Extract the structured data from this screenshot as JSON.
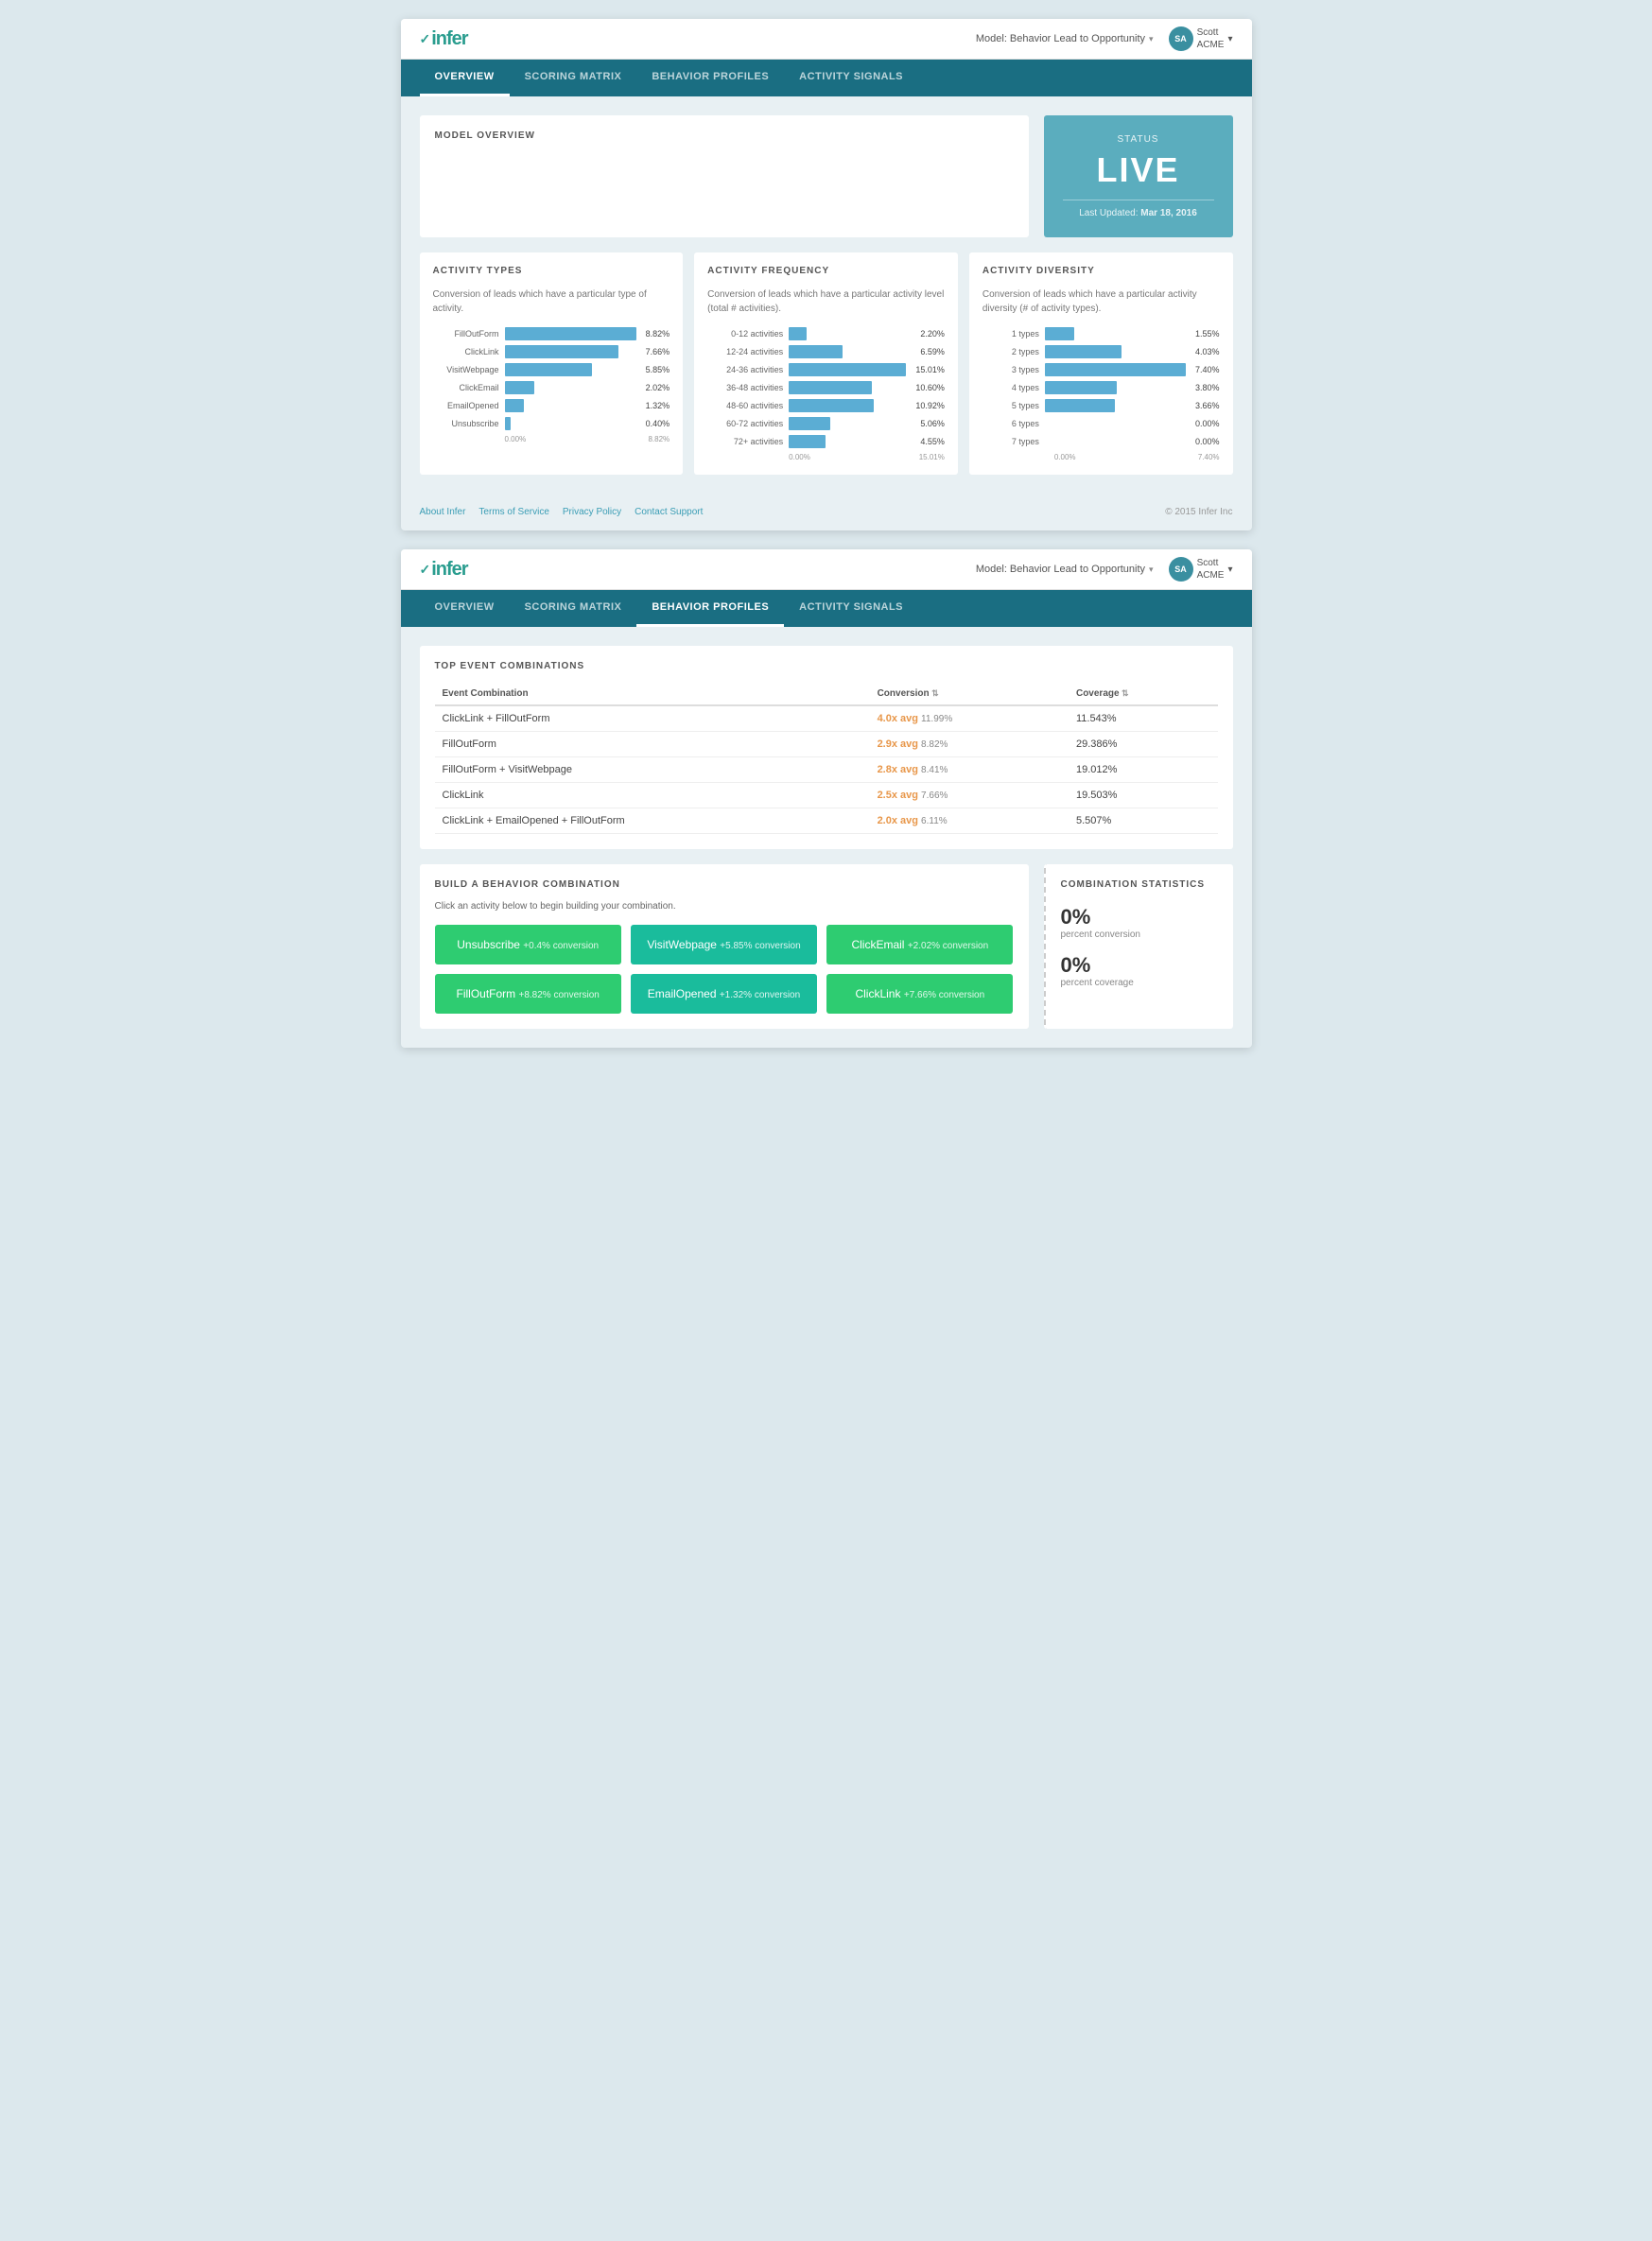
{
  "screen1": {
    "logo": "infer",
    "model_selector": "Model: Behavior Lead to Opportunity",
    "user_name": "Scott",
    "user_company": "ACME",
    "nav_tabs": [
      "OVERVIEW",
      "SCORING MATRIX",
      "BEHAVIOR PROFILES",
      "ACTIVITY SIGNALS"
    ],
    "active_tab": "OVERVIEW",
    "model_overview_title": "MODEL OVERVIEW",
    "status_label": "STATUS",
    "status_value": "LIVE",
    "status_updated": "Last Updated:",
    "status_date": "Mar 18, 2016",
    "activity_types": {
      "title": "ACTIVITY TYPES",
      "description": "Conversion of leads which have a particular type of activity.",
      "bars": [
        {
          "label": "FillOutForm",
          "value": 8.82,
          "max": 8.82,
          "display": "8.82%"
        },
        {
          "label": "ClickLink",
          "value": 7.66,
          "max": 8.82,
          "display": "7.66%"
        },
        {
          "label": "VisitWebpage",
          "value": 5.85,
          "max": 8.82,
          "display": "5.85%"
        },
        {
          "label": "ClickEmail",
          "value": 2.02,
          "max": 8.82,
          "display": "2.02%"
        },
        {
          "label": "EmailOpened",
          "value": 1.32,
          "max": 8.82,
          "display": "1.32%"
        },
        {
          "label": "Unsubscribe",
          "value": 0.4,
          "max": 8.82,
          "display": "0.40%"
        }
      ],
      "axis_min": "0.00%",
      "axis_max": "8.82%"
    },
    "activity_frequency": {
      "title": "ACTIVITY FREQUENCY",
      "description": "Conversion of leads which have a particular activity level (total # activities).",
      "bars": [
        {
          "label": "0-12 activities",
          "value": 2.2,
          "max": 15.01,
          "display": "2.20%"
        },
        {
          "label": "12-24 activities",
          "value": 6.59,
          "max": 15.01,
          "display": "6.59%"
        },
        {
          "label": "24-36 activities",
          "value": 15.01,
          "max": 15.01,
          "display": "15.01%"
        },
        {
          "label": "36-48 activities",
          "value": 10.6,
          "max": 15.01,
          "display": "10.60%"
        },
        {
          "label": "48-60 activities",
          "value": 10.92,
          "max": 15.01,
          "display": "10.92%"
        },
        {
          "label": "60-72 activities",
          "value": 5.06,
          "max": 15.01,
          "display": "5.06%"
        },
        {
          "label": "72+ activities",
          "value": 4.55,
          "max": 15.01,
          "display": "4.55%"
        }
      ],
      "axis_min": "0.00%",
      "axis_max": "15.01%"
    },
    "activity_diversity": {
      "title": "ACTIVITY DIVERSITY",
      "description": "Conversion of leads which have a particular activity diversity (# of activity types).",
      "bars": [
        {
          "label": "1 types",
          "value": 1.55,
          "max": 7.4,
          "display": "1.55%"
        },
        {
          "label": "2 types",
          "value": 4.03,
          "max": 7.4,
          "display": "4.03%"
        },
        {
          "label": "3 types",
          "value": 7.4,
          "max": 7.4,
          "display": "7.40%"
        },
        {
          "label": "4 types",
          "value": 3.8,
          "max": 7.4,
          "display": "3.80%"
        },
        {
          "label": "5 types",
          "value": 3.66,
          "max": 7.4,
          "display": "3.66%"
        },
        {
          "label": "6 types",
          "value": 0.0,
          "max": 7.4,
          "display": "0.00%"
        },
        {
          "label": "7 types",
          "value": 0.0,
          "max": 7.4,
          "display": "0.00%"
        }
      ],
      "axis_min": "0.00%",
      "axis_max": "7.40%"
    },
    "footer": {
      "links": [
        "About Infer",
        "Terms of Service",
        "Privacy Policy",
        "Contact Support"
      ],
      "copyright": "© 2015 Infer Inc"
    }
  },
  "screen2": {
    "logo": "infer",
    "model_selector": "Model: Behavior Lead to Opportunity",
    "user_name": "Scott",
    "user_company": "ACME",
    "nav_tabs": [
      "OVERVIEW",
      "SCORING MATRIX",
      "BEHAVIOR PROFILES",
      "ACTIVITY SIGNALS"
    ],
    "active_tab": "BEHAVIOR PROFILES",
    "top_event_combinations": {
      "title": "TOP EVENT COMBINATIONS",
      "columns": [
        "Event Combination",
        "Conversion",
        "Coverage"
      ],
      "rows": [
        {
          "event": "ClickLink + FillOutForm",
          "conv_mult": "4.0x avg",
          "conv_pct": "11.99%",
          "coverage": "11.543%"
        },
        {
          "event": "FillOutForm",
          "conv_mult": "2.9x avg",
          "conv_pct": "8.82%",
          "coverage": "29.386%"
        },
        {
          "event": "FillOutForm + VisitWebpage",
          "conv_mult": "2.8x avg",
          "conv_pct": "8.41%",
          "coverage": "19.012%"
        },
        {
          "event": "ClickLink",
          "conv_mult": "2.5x avg",
          "conv_pct": "7.66%",
          "coverage": "19.503%"
        },
        {
          "event": "ClickLink + EmailOpened + FillOutForm",
          "conv_mult": "2.0x avg",
          "conv_pct": "6.11%",
          "coverage": "5.507%"
        }
      ]
    },
    "build_combination": {
      "title": "BUILD A BEHAVIOR COMBINATION",
      "description": "Click an activity below to begin building your combination.",
      "buttons": [
        {
          "name": "Unsubscribe",
          "conv": "+0.4% conversion",
          "color": "green"
        },
        {
          "name": "VisitWebpage",
          "conv": "+5.85% conversion",
          "color": "teal"
        },
        {
          "name": "ClickEmail",
          "conv": "+2.02% conversion",
          "color": "green"
        },
        {
          "name": "FillOutForm",
          "conv": "+8.82% conversion",
          "color": "green"
        },
        {
          "name": "EmailOpened",
          "conv": "+1.32% conversion",
          "color": "teal"
        },
        {
          "name": "ClickLink",
          "conv": "+7.66% conversion",
          "color": "green"
        }
      ]
    },
    "combination_statistics": {
      "title": "COMBINATION STATISTICS",
      "percent_conversion_value": "0%",
      "percent_conversion_label": "percent conversion",
      "percent_coverage_value": "0%",
      "percent_coverage_label": "percent coverage"
    }
  }
}
